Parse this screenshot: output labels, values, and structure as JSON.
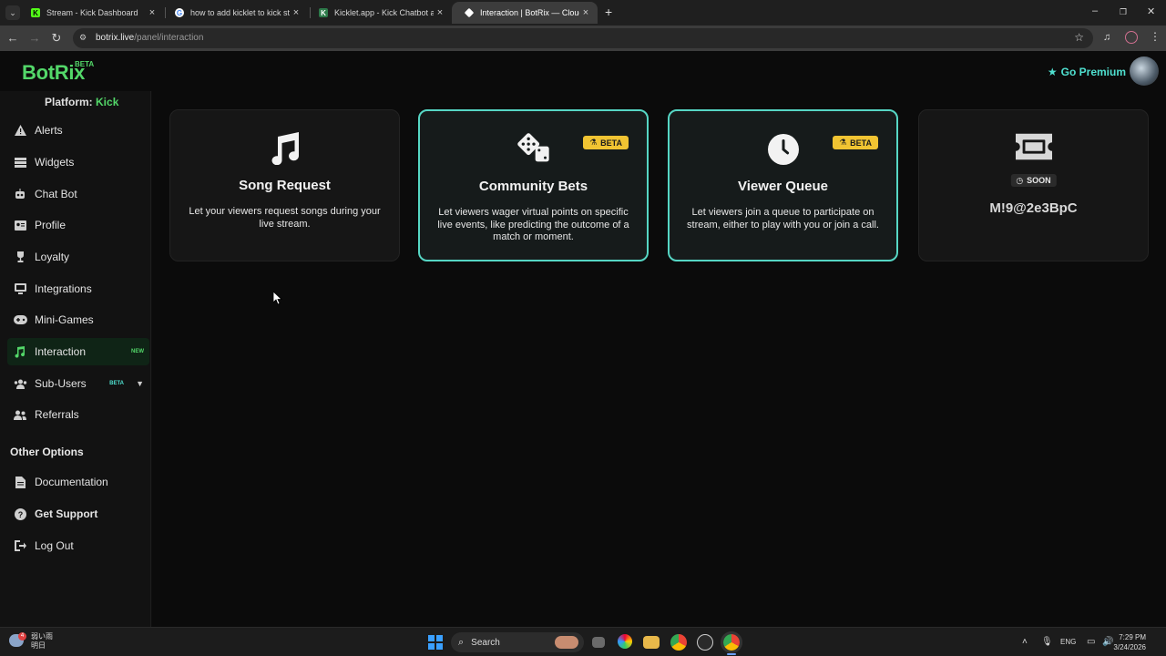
{
  "browser": {
    "tabs": [
      {
        "title": "Stream - Kick Dashboard",
        "active": false
      },
      {
        "title": "how to add kicklet to kick strea",
        "active": false
      },
      {
        "title": "Kicklet.app - Kick Chatbot and",
        "active": false
      },
      {
        "title": "Interaction | BotRix — Cloud St",
        "active": true
      }
    ],
    "url_host": "botrix.live",
    "url_path": "/panel/interaction",
    "new_tab": "+",
    "close": "×",
    "back": "←",
    "forward": "→",
    "reload": "↻",
    "min": "–",
    "max": "❐",
    "winclose": "✕"
  },
  "header": {
    "logo": "BotRix",
    "logo_badge": "BETA",
    "premium": "Go Premium"
  },
  "sidebar": {
    "platform_label": "Platform:",
    "platform_value": "Kick",
    "items": [
      {
        "label": "Alerts"
      },
      {
        "label": "Widgets"
      },
      {
        "label": "Chat Bot"
      },
      {
        "label": "Profile"
      },
      {
        "label": "Loyalty"
      },
      {
        "label": "Integrations"
      },
      {
        "label": "Mini-Games"
      },
      {
        "label": "Interaction",
        "badge": "NEW"
      },
      {
        "label": "Sub-Users",
        "badge": "BETA"
      },
      {
        "label": "Referrals"
      }
    ],
    "other_heading": "Other Options",
    "other_items": [
      {
        "label": "Documentation"
      },
      {
        "label": "Get Support"
      },
      {
        "label": "Log Out"
      }
    ]
  },
  "cards": [
    {
      "title": "Song Request",
      "desc": "Let your viewers request songs during your live stream.",
      "icon": "music-note-icon"
    },
    {
      "title": "Community Bets",
      "desc": "Let viewers wager virtual points on specific live events, like predicting the outcome of a match or moment.",
      "badge": "BETA",
      "icon": "dice-icon"
    },
    {
      "title": "Viewer Queue",
      "desc": "Let viewers join a queue to participate on stream, either to play with you or join a call.",
      "badge": "BETA",
      "icon": "clock-icon"
    },
    {
      "badge": "SOON",
      "code": "M!9@2e3BpC",
      "icon": "ticket-icon"
    }
  ],
  "taskbar": {
    "weather_line1": "弱い雨",
    "weather_line2": "明日",
    "search": "Search",
    "lang": "ENG",
    "time": "7:29 PM",
    "date": "3/24/2026"
  }
}
